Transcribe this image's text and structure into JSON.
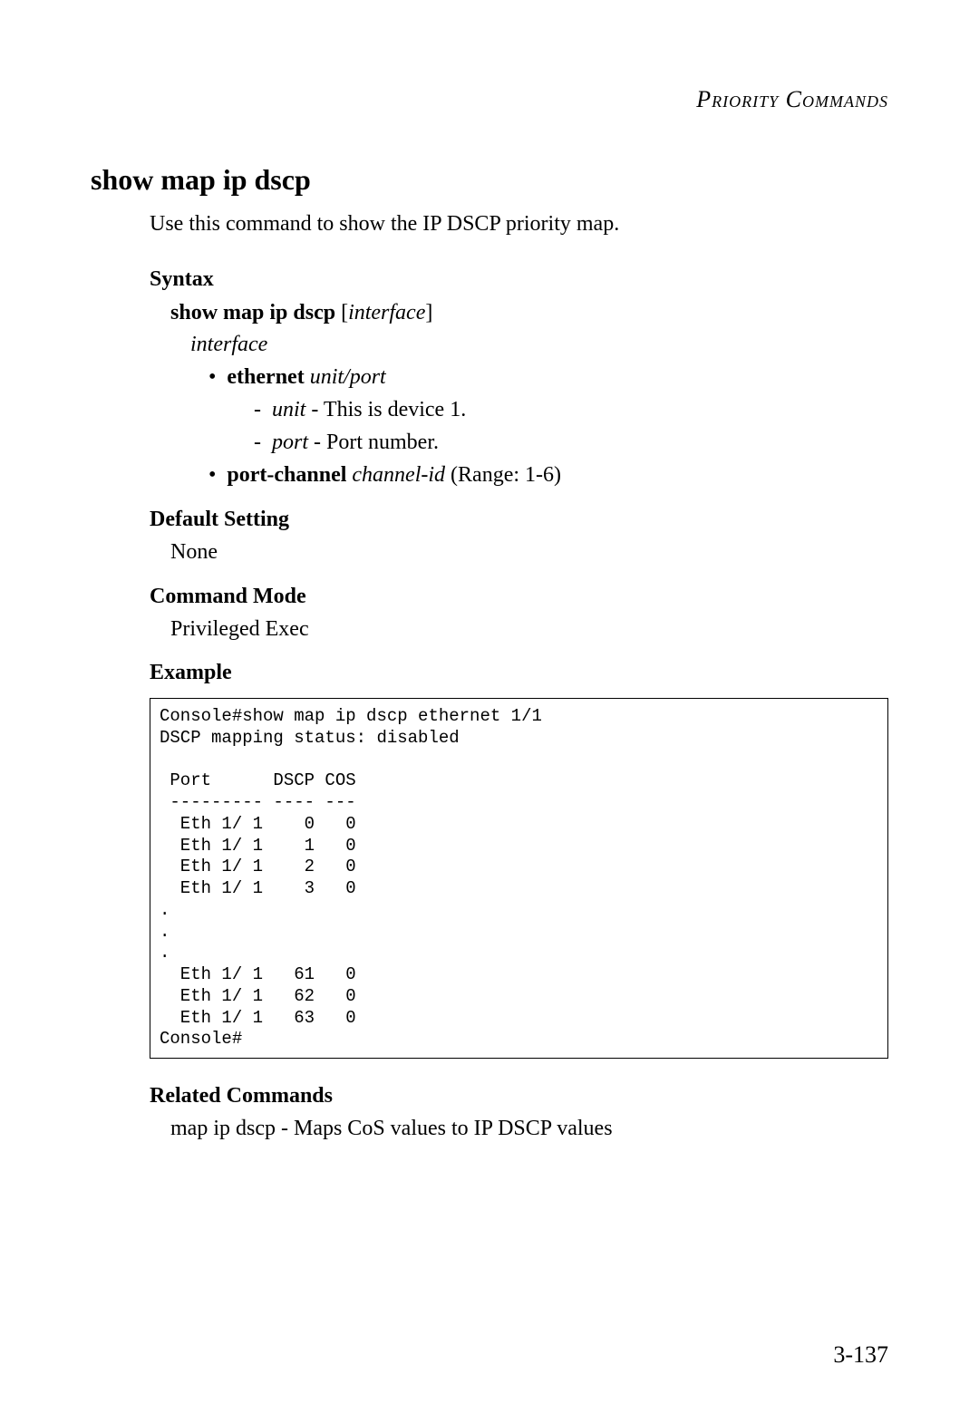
{
  "header": "Priority Commands",
  "title": "show map ip dscp",
  "intro": "Use this command to show the IP DSCP priority map.",
  "syntax": {
    "label": "Syntax",
    "command": "show map ip dscp",
    "bracket_open": "[",
    "param": "interface",
    "bracket_close": "]",
    "param2": "interface",
    "eth_bold": "ethernet",
    "eth_italic": "unit",
    "eth_slash": "/",
    "eth_italic2": "port",
    "unit_label": "unit",
    "unit_desc": " - This is device 1.",
    "port_label": "port",
    "port_desc": " - Port number.",
    "pc_bold": "port-channel",
    "pc_italic": "channel-id",
    "pc_desc": " (Range: 1-6)"
  },
  "default": {
    "label": "Default Setting",
    "value": "None"
  },
  "mode": {
    "label": "Command Mode",
    "value": "Privileged Exec"
  },
  "example": {
    "label": "Example",
    "code": "Console#show map ip dscp ethernet 1/1\nDSCP mapping status: disabled\n\n Port      DSCP COS\n --------- ---- ---\n  Eth 1/ 1    0   0\n  Eth 1/ 1    1   0\n  Eth 1/ 1    2   0\n  Eth 1/ 1    3   0\n.\n.\n.\n  Eth 1/ 1   61   0\n  Eth 1/ 1   62   0\n  Eth 1/ 1   63   0\nConsole#"
  },
  "related": {
    "label": "Related Commands",
    "value": "map ip dscp - Maps CoS values to IP DSCP values"
  },
  "page_number": "3-137"
}
